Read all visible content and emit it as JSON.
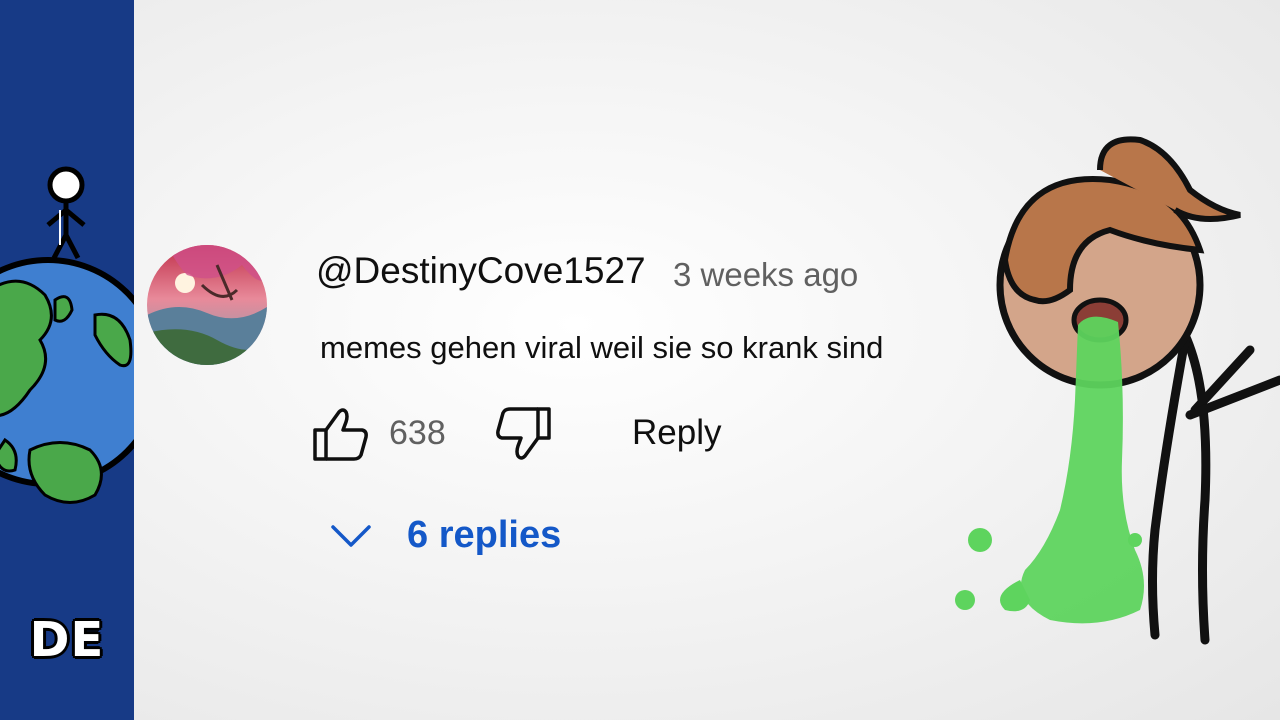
{
  "brand": {
    "badge": "DE",
    "logo_icon": "stick-figure-on-globe-icon"
  },
  "comment": {
    "author": "@DestinyCove1527",
    "timestamp": "3 weeks ago",
    "text": "memes gehen viral weil sie so krank sind",
    "avatar_icon": "cherry-blossom-landscape-avatar",
    "actions": {
      "like_icon": "thumbs-up-icon",
      "like_count": "638",
      "dislike_icon": "thumbs-down-icon",
      "reply_label": "Reply"
    },
    "replies": {
      "toggle_icon": "chevron-down-icon",
      "label": "6 replies"
    }
  },
  "illustration": {
    "icon": "vomiting-character-illustration"
  },
  "colors": {
    "sidebar": "#173a86",
    "replies_link": "#1458c8",
    "slime": "#5ed45e",
    "hair": "#b8764a",
    "skin": "#d3a58a"
  }
}
